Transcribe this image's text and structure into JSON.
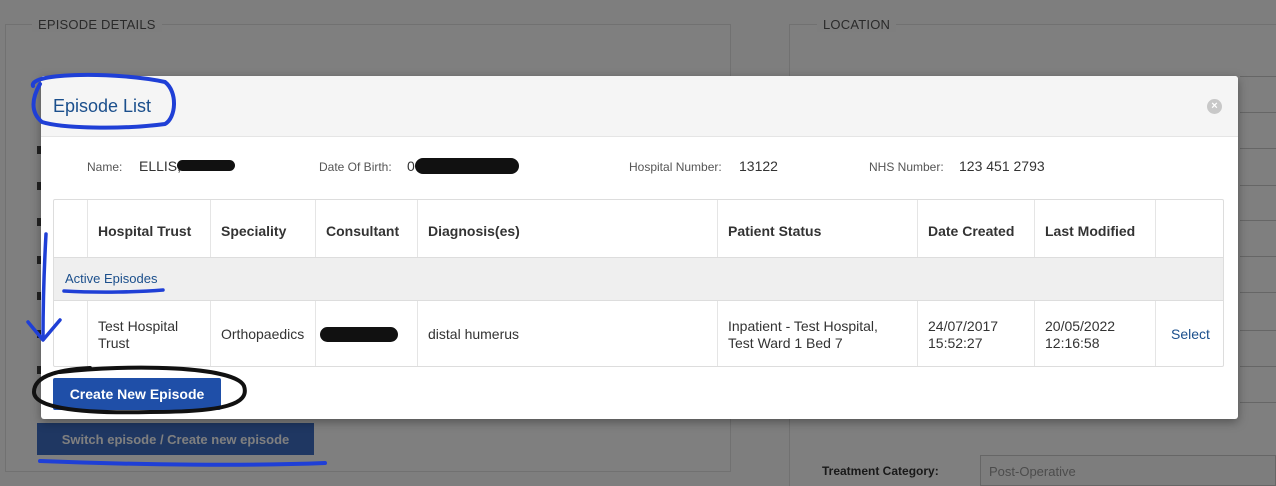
{
  "background": {
    "episode_legend": "EPISODE DETAILS",
    "location_legend": "LOCATION",
    "switch_button": "Switch episode / Create new episode",
    "treatment_category_label": "Treatment Category:",
    "treatment_category_value": "Post-Operative"
  },
  "modal": {
    "title": "Episode List",
    "close_glyph": "×"
  },
  "patient": {
    "name_label": "Name:",
    "name_value": "ELLIS,",
    "dob_label": "Date Of Birth:",
    "dob_value": "0",
    "hospital_number_label": "Hospital Number:",
    "hospital_number_value": "13122",
    "nhs_number_label": "NHS Number:",
    "nhs_number_value": "123 451 2793"
  },
  "table": {
    "headers": [
      "",
      "Hospital Trust",
      "Speciality",
      "Consultant",
      "Diagnosis(es)",
      "Patient Status",
      "Date Created",
      "Last Modified",
      ""
    ],
    "group_label": "Active Episodes",
    "rows": [
      {
        "hospital_trust": "Test Hospital Trust",
        "speciality": "Orthopaedics",
        "consultant": "",
        "diagnosis": "distal humerus",
        "patient_status": "Inpatient - Test Hospital, Test Ward 1 Bed 7",
        "date_created": "24/07/2017 15:52:27",
        "last_modified": "20/05/2022 12:16:58",
        "action": "Select"
      }
    ]
  },
  "buttons": {
    "create_new_episode": "Create New Episode"
  },
  "colors": {
    "accent": "#1b4f8c",
    "primary_button": "#1f4fa8",
    "annotation_blue": "#1f3fd6"
  }
}
